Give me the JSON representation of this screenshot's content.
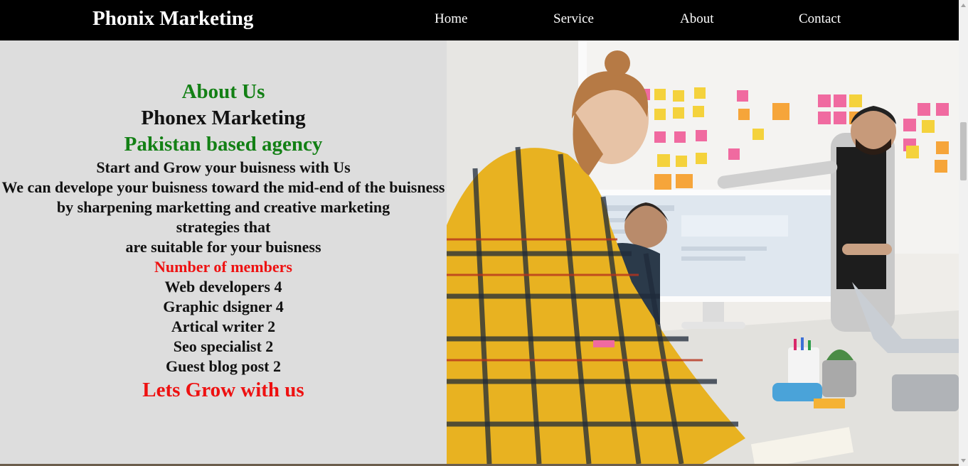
{
  "navbar": {
    "brand": "Phonix Marketing",
    "links": [
      "Home",
      "Service",
      "About",
      "Contact"
    ]
  },
  "about": {
    "heading": "About Us",
    "company": "Phonex Marketing",
    "tagline": "Pakistan based agency",
    "intro": "Start and Grow your buisness with Us",
    "description_lines": [
      "We can develope your buisness toward the mid-end of the buisness",
      "by sharpening marketting and creative marketing strategies that",
      "are suitable for your buisness"
    ],
    "members_heading": "Number of members",
    "members": [
      "Web developers 4",
      "Graphic dsigner 4",
      "Artical writer 2",
      "Seo specialist 2",
      "Guest blog post 2"
    ],
    "closing": "Lets Grow with us"
  },
  "colors": {
    "navbar_bg": "#000000",
    "about_bg": "#dddddd",
    "green_accent": "#138015",
    "red_accent": "#ee1111"
  },
  "hero_image": {
    "icon": "team-meeting-photo"
  }
}
